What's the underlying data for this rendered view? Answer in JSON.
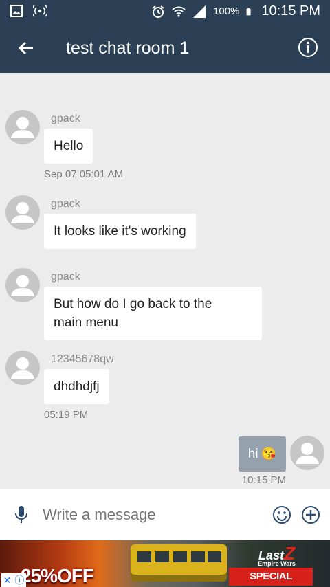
{
  "status_bar": {
    "battery_percent": "100%",
    "time": "10:15 PM",
    "icons": [
      "image-icon",
      "hotspot-icon",
      "alarm-icon",
      "wifi-icon",
      "signal-icon",
      "battery-icon"
    ]
  },
  "app_bar": {
    "title": "test chat room 1",
    "back_icon": "arrow-left-icon",
    "info_icon": "info-icon",
    "color": "#2b4054"
  },
  "messages": [
    {
      "sender": "gpack",
      "text": "Hello",
      "timestamp": "Sep 07 05:01 AM"
    },
    {
      "sender": "gpack",
      "text": "It looks like it's working",
      "timestamp": ""
    },
    {
      "sender": "gpack",
      "text_line1": "But how do I go back to the",
      "text_line2": "main menu",
      "timestamp": ""
    },
    {
      "sender": "12345678qw",
      "text": "dhdhdjfj",
      "timestamp": "05:19 PM"
    }
  ],
  "outgoing": {
    "text": "hi",
    "emoji": "😘",
    "timestamp": "10:15 PM",
    "bubble_color": "#95a2ae"
  },
  "composer": {
    "placeholder": "Write a message"
  },
  "ad": {
    "sale_text": "25%OFF",
    "logo_top": "Last",
    "logo_z": "Z",
    "logo_sub": "Empire Wars",
    "discount_text": "SPECIAL DISCOUNT"
  }
}
